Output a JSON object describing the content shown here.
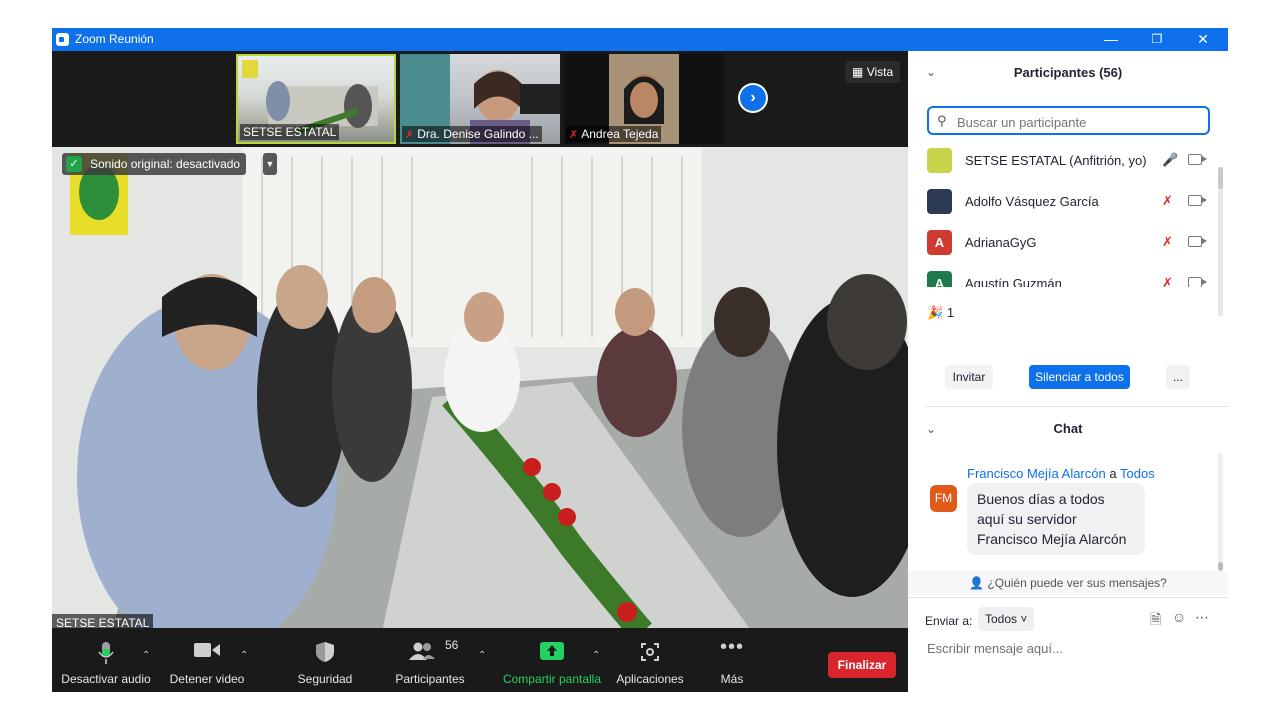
{
  "window": {
    "title": "Zoom Reunión"
  },
  "strip": {
    "thumbs": [
      {
        "name": "SETSE ESTATAL"
      },
      {
        "name": "Dra. Denise Galindo ..."
      },
      {
        "name": "Andrea Tejeda"
      }
    ],
    "view_label": "Vista"
  },
  "main_video": {
    "sound_label": "Sonido original: desactivado",
    "name": "SETSE ESTATAL"
  },
  "toolbar": {
    "mute": "Desactivar audio",
    "video": "Detener video",
    "security": "Seguridad",
    "participants": "Participantes",
    "participants_count": "56",
    "share": "Compartir pantalla",
    "apps": "Aplicaciones",
    "more": "Más",
    "end": "Finalizar"
  },
  "participants_panel": {
    "title": "Participantes (56)",
    "search_placeholder": "Buscar un participante",
    "participants": [
      {
        "name": "SETSE ESTATAL (Anfitrión, yo)",
        "avatar_letter": "",
        "avatar_color": "#c8d44a",
        "muted": false
      },
      {
        "name": "Adolfo Vásquez García",
        "avatar_letter": "",
        "avatar_color": "#2c3a55",
        "muted": true
      },
      {
        "name": "AdrianaGyG",
        "avatar_letter": "A",
        "avatar_color": "#d13a2e",
        "muted": true
      },
      {
        "name": "Agustín Guzmán",
        "avatar_letter": "A",
        "avatar_color": "#1e7a4a",
        "muted": true
      }
    ],
    "reaction_count": "1",
    "invite": "Invitar",
    "mute_all": "Silenciar a todos",
    "more": "..."
  },
  "chat": {
    "title": "Chat",
    "message": {
      "sender": "Francisco Mejía Alarcón",
      "to_word": "a",
      "recipient": "Todos",
      "avatar": "FM",
      "lines": [
        "Buenos días a todos",
        "aquí su servidor",
        "Francisco Mejía Alarcón"
      ]
    },
    "who_can_see": "¿Quién puede ver sus mensajes?",
    "send_to_label": "Enviar a:",
    "send_to_value": "Todos",
    "input_placeholder": "Escribir mensaje aquí..."
  }
}
